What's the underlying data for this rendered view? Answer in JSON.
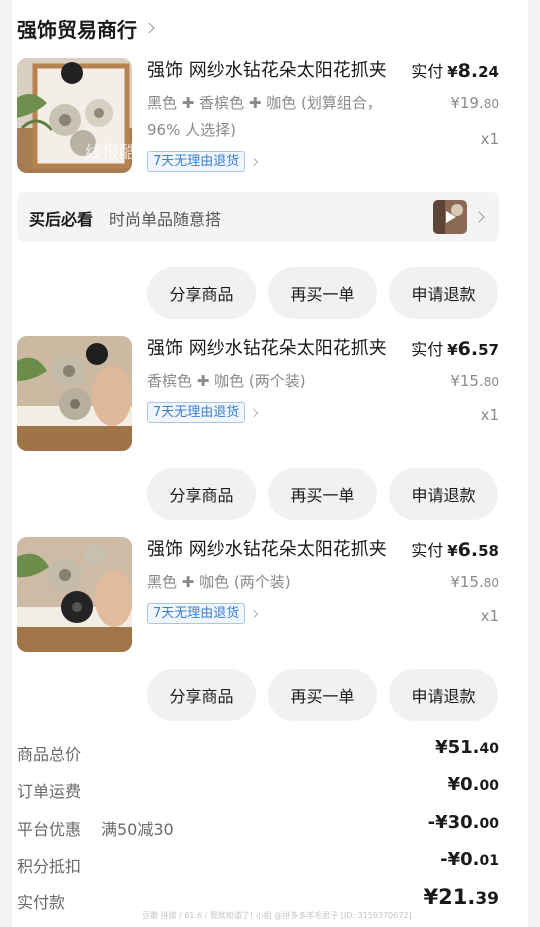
{
  "shop": {
    "name": "强饰贸易商行"
  },
  "items": [
    {
      "title": "强饰 网纱水钻花朵太阳花抓夹",
      "spec": "黑色 ✚ 香槟色 ✚ 咖色 (划算组合，96% 人选择)",
      "paid_label": "实付",
      "paid_sym": "¥",
      "paid_int": "8.",
      "paid_dec": "24",
      "orig_int": "¥19.",
      "orig_dec": "80",
      "qty": "x1",
      "tag": "7天无理由退货"
    },
    {
      "title": "强饰 网纱水钻花朵太阳花抓夹",
      "spec": "香槟色 ✚ 咖色 (两个装)",
      "paid_label": "实付",
      "paid_sym": "¥",
      "paid_int": "6.",
      "paid_dec": "57",
      "orig_int": "¥15.",
      "orig_dec": "80",
      "qty": "x1",
      "tag": "7天无理由退货"
    },
    {
      "title": "强饰 网纱水钻花朵太阳花抓夹",
      "spec": "黑色 ✚ 咖色 (两个装)",
      "paid_label": "实付",
      "paid_sym": "¥",
      "paid_int": "6.",
      "paid_dec": "58",
      "orig_int": "¥15.",
      "orig_dec": "80",
      "qty": "x1",
      "tag": "7天无理由退货"
    }
  ],
  "must_buy": {
    "label": "买后必看",
    "text": "时尚单品随意搭"
  },
  "actions": {
    "share": "分享商品",
    "rebuy": "再买一单",
    "refund": "申请退款"
  },
  "summary": {
    "total": {
      "label": "商品总价",
      "int": "¥51.",
      "dec": "40"
    },
    "shipping": {
      "label": "订单运费",
      "int": "¥0.",
      "dec": "00"
    },
    "platform": {
      "label": "平台优惠",
      "extra": "满50减30",
      "int": "-¥30.",
      "dec": "00"
    },
    "points": {
      "label": "积分抵扣",
      "int": "-¥0.",
      "dec": "01"
    },
    "paid": {
      "label": "实付款",
      "int": "¥21.",
      "dec": "39"
    }
  },
  "watermark": "线报酷 new.xianbao.fun",
  "footer_note": "豆瓣 拼娘 / 61.6 / 我就知道了! 小姐 @拼多多羊毛君子 [ID: 3159370672]",
  "colors": {
    "accent_tag": "#3b7fd1",
    "price": "#1a1a1a",
    "muted": "#8a8a8a"
  }
}
